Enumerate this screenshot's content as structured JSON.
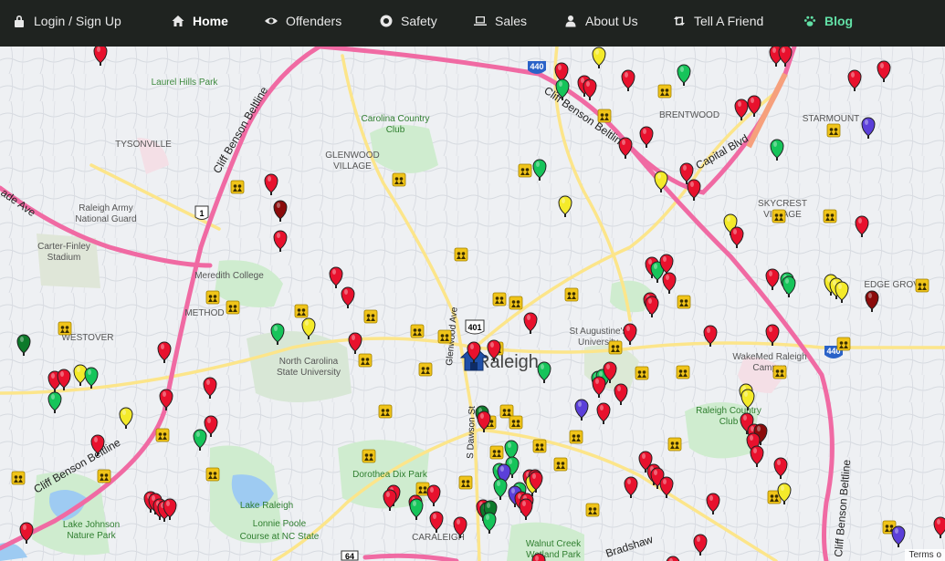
{
  "nav": {
    "items": [
      {
        "label": "Login / Sign Up",
        "icon": "lock-icon"
      },
      {
        "label": "Home",
        "icon": "home-icon"
      },
      {
        "label": "Offenders",
        "icon": "eye-icon"
      },
      {
        "label": "Safety",
        "icon": "life-ring-icon"
      },
      {
        "label": "Sales",
        "icon": "laptop-icon"
      },
      {
        "label": "About Us",
        "icon": "user-icon"
      },
      {
        "label": "Tell A Friend",
        "icon": "retweet-icon"
      },
      {
        "label": "Blog",
        "icon": "paw-icon"
      }
    ]
  },
  "map": {
    "labels": {
      "laurel_hills_park": "Laurel Hills Park",
      "tysonville": "TYSONVILLE",
      "glenwood": "GLENWOOD",
      "village": "VILLAGE",
      "carolina_country": "Carolina Country",
      "club": "Club",
      "brentwood": "BRENTWOOD",
      "starmount": "STARMOUNT",
      "raleigh_army": "Raleigh Army",
      "national_guard": "National Guard",
      "carter_finley": "Carter-Finley",
      "stadium": "Stadium",
      "meredith_college": "Meredith College",
      "method": "METHOD",
      "westover": "WESTOVER",
      "ncsu1": "North Carolina",
      "ncsu2": "State University",
      "st_augustine1": "St Augustine's",
      "st_augustine2": "University",
      "skycrest1": "SKYCREST",
      "skycrest2": "VILLAGE",
      "wakemed1": "WakeMed Raleigh",
      "wakemed2": "Campus",
      "raleigh_country1": "Raleigh Country",
      "raleigh_country2": "Club",
      "dorothea_dix": "Dorothea Dix Park",
      "lake_raleigh": "Lake Raleigh",
      "lonnie_poole1": "Lonnie Poole",
      "lonnie_poole2": "Course at NC State",
      "lake_johnson1": "Lake Johnson",
      "lake_johnson2": "Nature Park",
      "caraleigh": "CARALEIGH",
      "walnut_creek1": "Walnut Creek",
      "walnut_creek2": "Wetland Park",
      "raleigh": "Raleigh",
      "glenwood_ave": "Glenwood Ave",
      "s_dawson": "S Dawson St",
      "capital_blvd": "Capital Blvd",
      "cliff_benson_1": "Cliff Benson Beltline",
      "cliff_benson_2": "Cliff Benson Beltline",
      "cliff_benson_3": "Cliff Benson Beltline",
      "cliff_benson_4": "Cliff Benson Beltline",
      "bradshaw": "Bradshaw",
      "edge_grove": "EDGE GROVE",
      "wade_ave": "ade Ave",
      "hwy440a": "440",
      "hwy440b": "440",
      "hwy401": "401",
      "hwy1": "1",
      "hwy64": "64"
    },
    "terms": "Terms o",
    "colors": {
      "red": "#e8112d",
      "green": "#16c45a",
      "yellow": "#f4ea2a",
      "darkred": "#8b0b0b",
      "purple": "#5b3fd9",
      "darkgreen": "#0d7a2a",
      "highway": "#f06aa3",
      "major_road": "#fce58a",
      "park": "#cfeccf",
      "water": "#9ecbf2"
    }
  }
}
